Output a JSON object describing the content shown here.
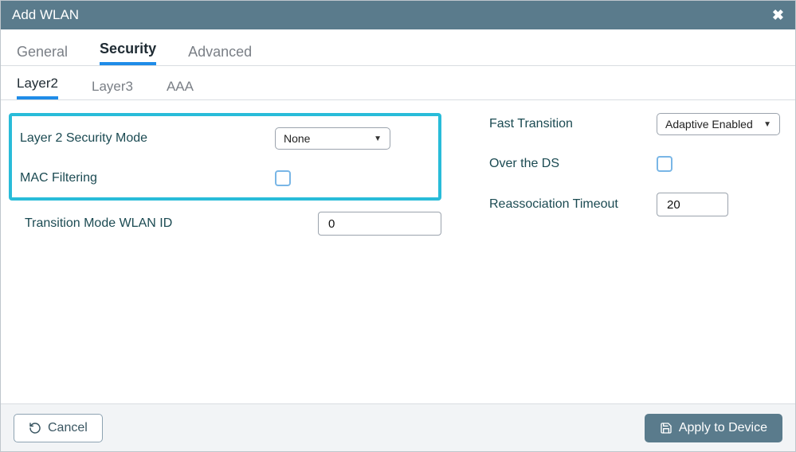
{
  "header": {
    "title": "Add WLAN"
  },
  "tabsPrimary": {
    "general": "General",
    "security": "Security",
    "advanced": "Advanced"
  },
  "tabsSecondary": {
    "layer2": "Layer2",
    "layer3": "Layer3",
    "aaa": "AAA"
  },
  "fields": {
    "layer2SecurityMode": {
      "label": "Layer 2 Security Mode",
      "value": "None"
    },
    "macFiltering": {
      "label": "MAC Filtering"
    },
    "transitionModeWlanId": {
      "label": "Transition Mode WLAN ID",
      "value": "0"
    },
    "fastTransition": {
      "label": "Fast Transition",
      "value": "Adaptive Enabled"
    },
    "overTheDs": {
      "label": "Over the DS"
    },
    "reassociationTimeout": {
      "label": "Reassociation Timeout",
      "value": "20"
    }
  },
  "footer": {
    "cancel": "Cancel",
    "apply": "Apply to Device"
  }
}
